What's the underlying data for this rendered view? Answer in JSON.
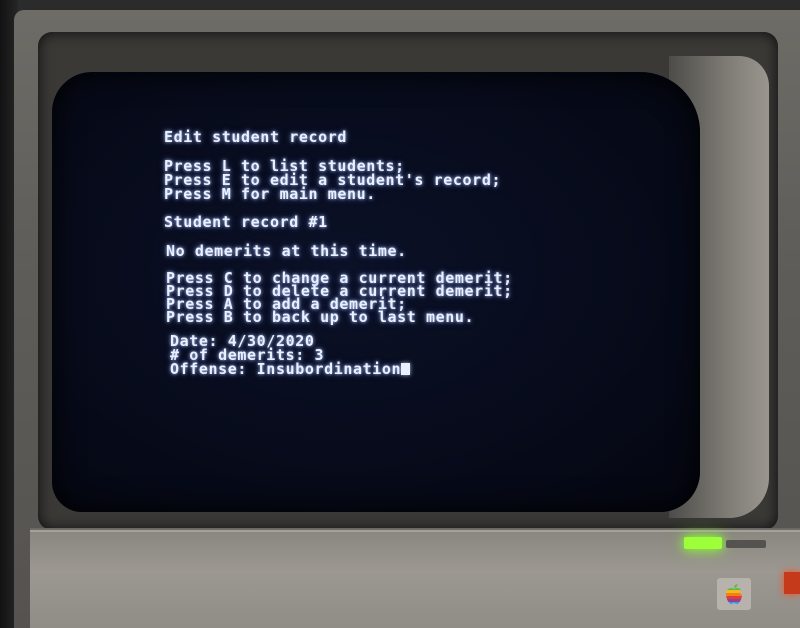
{
  "screen": {
    "title": "Edit student record",
    "menu_lines": [
      "Press L to list students;",
      "Press E to edit a student's record;",
      "Press M for main menu."
    ],
    "record_heading": "Student record #1",
    "status_message": "No demerits at this time.",
    "record_options": [
      "Press C to change a current demerit;",
      "Press D to delete a current demerit;",
      "Press A to add a demerit;",
      "Press B to back up to last menu."
    ],
    "form": {
      "date_line": "Date: 4/30/2020",
      "count_line": "# of demerits: 3",
      "offense_line": "Offense: Insubordination"
    }
  },
  "colors": {
    "phosphor": "#e9f0ff",
    "screen_bg": "#070b1b",
    "power_led": "#9dff3a"
  },
  "icons": {
    "logo": "apple-rainbow-logo",
    "cursor": "block-cursor"
  }
}
